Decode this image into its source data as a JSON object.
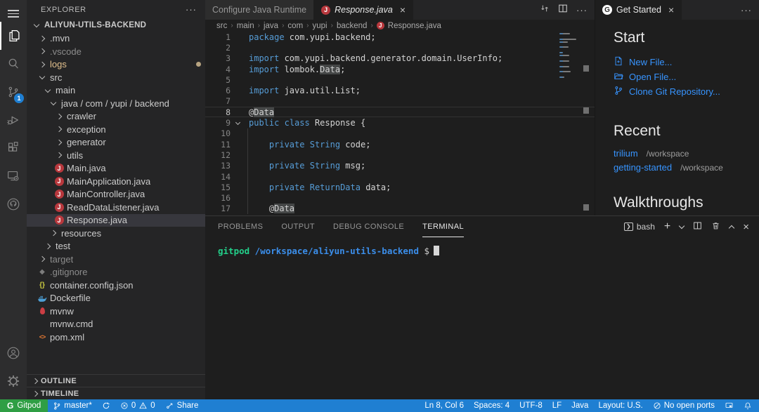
{
  "activity_bar": {
    "scm_badge": "1"
  },
  "explorer": {
    "header": "EXPLORER",
    "tree": [
      {
        "label": "ALIYUN-UTILS-BACKEND",
        "level": 0,
        "type": "folder",
        "state": "expanded",
        "root": true
      },
      {
        "label": ".mvn",
        "level": 1,
        "type": "folder",
        "state": "collapsed"
      },
      {
        "label": ".vscode",
        "level": 1,
        "type": "folder",
        "state": "collapsed",
        "cls": "dim"
      },
      {
        "label": "logs",
        "level": 1,
        "type": "folder",
        "state": "collapsed",
        "cls": "modified",
        "dot": true
      },
      {
        "label": "src",
        "level": 1,
        "type": "folder",
        "state": "expanded"
      },
      {
        "label": "main",
        "level": 2,
        "type": "folder",
        "state": "expanded"
      },
      {
        "label": "java / com / yupi / backend",
        "level": 3,
        "type": "folder",
        "state": "expanded"
      },
      {
        "label": "crawler",
        "level": 4,
        "type": "folder",
        "state": "collapsed"
      },
      {
        "label": "exception",
        "level": 4,
        "type": "folder",
        "state": "collapsed"
      },
      {
        "label": "generator",
        "level": 4,
        "type": "folder",
        "state": "collapsed"
      },
      {
        "label": "utils",
        "level": 4,
        "type": "folder",
        "state": "collapsed"
      },
      {
        "label": "Main.java",
        "level": 4,
        "type": "file",
        "icon": "java-file-icon"
      },
      {
        "label": "MainApplication.java",
        "level": 4,
        "type": "file",
        "icon": "java-file-icon"
      },
      {
        "label": "MainController.java",
        "level": 4,
        "type": "file",
        "icon": "java-file-icon"
      },
      {
        "label": "ReadDataListener.java",
        "level": 4,
        "type": "file",
        "icon": "java-file-icon"
      },
      {
        "label": "Response.java",
        "level": 4,
        "type": "file",
        "icon": "java-file-icon",
        "selected": true
      },
      {
        "label": "resources",
        "level": 3,
        "type": "folder",
        "state": "collapsed"
      },
      {
        "label": "test",
        "level": 2,
        "type": "folder",
        "state": "collapsed"
      },
      {
        "label": "target",
        "level": 1,
        "type": "folder",
        "state": "collapsed",
        "cls": "dim"
      },
      {
        "label": ".gitignore",
        "level": 1,
        "type": "file",
        "icon": "gitignore-file-icon",
        "cls": "dim"
      },
      {
        "label": "container.config.json",
        "level": 1,
        "type": "file",
        "icon": "json-file-icon"
      },
      {
        "label": "Dockerfile",
        "level": 1,
        "type": "file",
        "icon": "docker-file-icon"
      },
      {
        "label": "mvnw",
        "level": 1,
        "type": "file",
        "icon": "maven-file-icon"
      },
      {
        "label": "mvnw.cmd",
        "level": 1,
        "type": "file",
        "icon": "windows-file-icon"
      },
      {
        "label": "pom.xml",
        "level": 1,
        "type": "file",
        "icon": "xml-file-icon"
      }
    ],
    "sections": {
      "outline": "OUTLINE",
      "timeline": "TIMELINE"
    }
  },
  "editor": {
    "tabs": [
      {
        "label": "Configure Java Runtime",
        "active": false,
        "icon": null,
        "close": false
      },
      {
        "label": "Response.java",
        "active": true,
        "icon": "java",
        "close": true,
        "preview": true
      }
    ],
    "breadcrumb": [
      "src",
      "main",
      "java",
      "com",
      "yupi",
      "backend"
    ],
    "breadcrumb_file": "Response.java",
    "code_lines": [
      {
        "num": 1,
        "tokens": [
          [
            "kw",
            "package"
          ],
          [
            "pl",
            " com.yupi.backend;"
          ]
        ]
      },
      {
        "num": 2,
        "tokens": []
      },
      {
        "num": 3,
        "tokens": [
          [
            "kw",
            "import"
          ],
          [
            "pl",
            " com.yupi.backend.generator.domain.UserInfo;"
          ]
        ]
      },
      {
        "num": 4,
        "tokens": [
          [
            "kw",
            "import"
          ],
          [
            "pl",
            " lombok."
          ],
          [
            "hl",
            "Data"
          ],
          [
            "pl",
            ";"
          ]
        ]
      },
      {
        "num": 5,
        "tokens": []
      },
      {
        "num": 6,
        "tokens": [
          [
            "kw",
            "import"
          ],
          [
            "pl",
            " java.util.List;"
          ]
        ]
      },
      {
        "num": 7,
        "tokens": []
      },
      {
        "num": 8,
        "tokens": [
          [
            "pl",
            "@"
          ],
          [
            "hl",
            "Data"
          ]
        ],
        "current": true
      },
      {
        "num": 9,
        "tokens": [
          [
            "kw",
            "public"
          ],
          [
            "pl",
            " "
          ],
          [
            "kw",
            "class"
          ],
          [
            "pl",
            " Response {"
          ]
        ],
        "fold": true
      },
      {
        "num": 10,
        "tokens": []
      },
      {
        "num": 11,
        "tokens": [
          [
            "pl",
            "    "
          ],
          [
            "kw",
            "private"
          ],
          [
            "pl",
            " "
          ],
          [
            "kw",
            "String"
          ],
          [
            "pl",
            " code;"
          ]
        ]
      },
      {
        "num": 12,
        "tokens": []
      },
      {
        "num": 13,
        "tokens": [
          [
            "pl",
            "    "
          ],
          [
            "kw",
            "private"
          ],
          [
            "pl",
            " "
          ],
          [
            "kw",
            "String"
          ],
          [
            "pl",
            " msg;"
          ]
        ]
      },
      {
        "num": 14,
        "tokens": []
      },
      {
        "num": 15,
        "tokens": [
          [
            "pl",
            "    "
          ],
          [
            "kw",
            "private"
          ],
          [
            "pl",
            " "
          ],
          [
            "kw",
            "ReturnData"
          ],
          [
            "pl",
            " data;"
          ]
        ]
      },
      {
        "num": 16,
        "tokens": []
      },
      {
        "num": 17,
        "tokens": [
          [
            "pl",
            "    @"
          ],
          [
            "hl",
            "Data"
          ]
        ]
      }
    ]
  },
  "get_started": {
    "tab_label": "Get Started",
    "start_heading": "Start",
    "start_links": [
      {
        "icon": "new-file-icon",
        "label": "New File..."
      },
      {
        "icon": "open-file-icon",
        "label": "Open File..."
      },
      {
        "icon": "clone-repo-icon",
        "label": "Clone Git Repository..."
      }
    ],
    "recent_heading": "Recent",
    "recent_items": [
      {
        "name": "trilium",
        "path": "/workspace"
      },
      {
        "name": "getting-started",
        "path": "/workspace"
      }
    ],
    "walkthroughs_heading": "Walkthroughs"
  },
  "panel": {
    "tabs": [
      "PROBLEMS",
      "OUTPUT",
      "DEBUG CONSOLE",
      "TERMINAL"
    ],
    "active_tab": "TERMINAL",
    "shell_label": "bash",
    "terminal": {
      "user": "gitpod",
      "path": " /workspace/aliyun-utils-backend",
      "prompt": " $"
    }
  },
  "status_bar": {
    "remote_label": "Gitpod",
    "branch_label": "master*",
    "errors": "0",
    "warnings": "0",
    "share_label": "Share",
    "right_items": [
      "Ln 8, Col 6",
      "Spaces: 4",
      "UTF-8",
      "LF",
      "Java",
      "Layout: U.S."
    ],
    "ports_label": "No open ports"
  },
  "colors": {
    "statusbar_blue": "#1f7fd2",
    "remote_green": "#2f9e44",
    "link_blue": "#3794ff",
    "keyword_blue": "#569cd6",
    "git_modified": "#e2c08d",
    "terminal_green": "#23d18b",
    "terminal_blue": "#3b8eea",
    "java_icon_red": "#b8383d"
  }
}
